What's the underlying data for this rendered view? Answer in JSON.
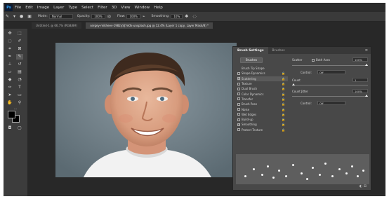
{
  "menubar": {
    "logo": "Ps",
    "items": [
      "File",
      "Edit",
      "Image",
      "Layer",
      "Type",
      "Select",
      "Filter",
      "3D",
      "View",
      "Window",
      "Help"
    ]
  },
  "options": {
    "mode_label": "Mode:",
    "mode_value": "Normal",
    "opacity_label": "Opacity:",
    "opacity_value": "100%",
    "flow_label": "Flow:",
    "flow_value": "100%",
    "smoothing_label": "Smoothing:",
    "smoothing_value": "10%"
  },
  "tabs": [
    {
      "label": "Untitled-1 @ 66.7% (RGB/8#)"
    },
    {
      "label": "sergey-mikheev-1982ySJ7eOk-unsplash.jpg @ 12.4% (Layer 1 copy, Layer Mask/8) *"
    }
  ],
  "brush_panel": {
    "tab_active": "Brush Settings",
    "tab_other": "Brushes",
    "brushes_button": "Brushes",
    "items": [
      {
        "label": "Brush Tip Shape",
        "check": "none",
        "lock": false
      },
      {
        "label": "Shape Dynamics",
        "check": "off",
        "lock": true
      },
      {
        "label": "Scattering",
        "check": "on",
        "lock": true,
        "selected": true
      },
      {
        "label": "Texture",
        "check": "off",
        "lock": true
      },
      {
        "label": "Dual Brush",
        "check": "off",
        "lock": true
      },
      {
        "label": "Color Dynamics",
        "check": "off",
        "lock": true
      },
      {
        "label": "Transfer",
        "check": "off",
        "lock": true
      },
      {
        "label": "Brush Pose",
        "check": "off",
        "lock": true
      },
      {
        "label": "Noise",
        "check": "off",
        "lock": true
      },
      {
        "label": "Wet Edges",
        "check": "off",
        "lock": true
      },
      {
        "label": "Build-up",
        "check": "off",
        "lock": true
      },
      {
        "label": "Smoothing",
        "check": "on",
        "lock": true
      },
      {
        "label": "Protect Texture",
        "check": "off",
        "lock": true
      }
    ],
    "scatter_label": "Scatter",
    "both_axes_label": "Both Axes",
    "scatter_value": "100%",
    "control_label": "Control:",
    "control_value": "Off",
    "count_label": "Count",
    "count_value": "1",
    "count_jitter_label": "Count Jitter",
    "count_jitter_value": "100%",
    "control2_label": "Control:",
    "control2_value": "Off"
  }
}
